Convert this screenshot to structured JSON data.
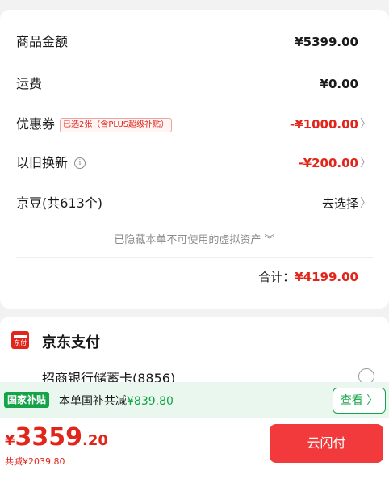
{
  "order_summary": {
    "goods_amount": {
      "label": "商品金额",
      "value": "¥5399.00"
    },
    "shipping": {
      "label": "运费",
      "value": "¥0.00"
    },
    "coupon": {
      "label": "优惠券",
      "tag": "已选2张（含PLUS超级补贴）",
      "value": "-¥1000.00"
    },
    "trade_in": {
      "label": "以旧换新",
      "info_icon": "info-icon",
      "value": "-¥200.00"
    },
    "jd_beans": {
      "label": "京豆(共613个)",
      "value": "去选择"
    },
    "hidden_note": "已隐藏本单不可使用的虚拟资产 ︾",
    "total_label": "合计：",
    "total_value": "¥4199.00"
  },
  "payment": {
    "logo_text": "东付",
    "title": "京东支付",
    "card": "招商银行储蓄卡(8856)"
  },
  "subsidy": {
    "tag": "国家补贴",
    "text_prefix": "本单国补共减",
    "amount": "¥839.80",
    "view_button": "查看 〉"
  },
  "bottom": {
    "currency": "¥",
    "price_int": "3359",
    "price_dec": ".20",
    "saved": "共减¥2039.80",
    "pay_button": "云闪付"
  },
  "colors": {
    "accent_red": "#e1251b",
    "subsidy_green": "#14a346",
    "pay_button": "#f23a3c"
  }
}
